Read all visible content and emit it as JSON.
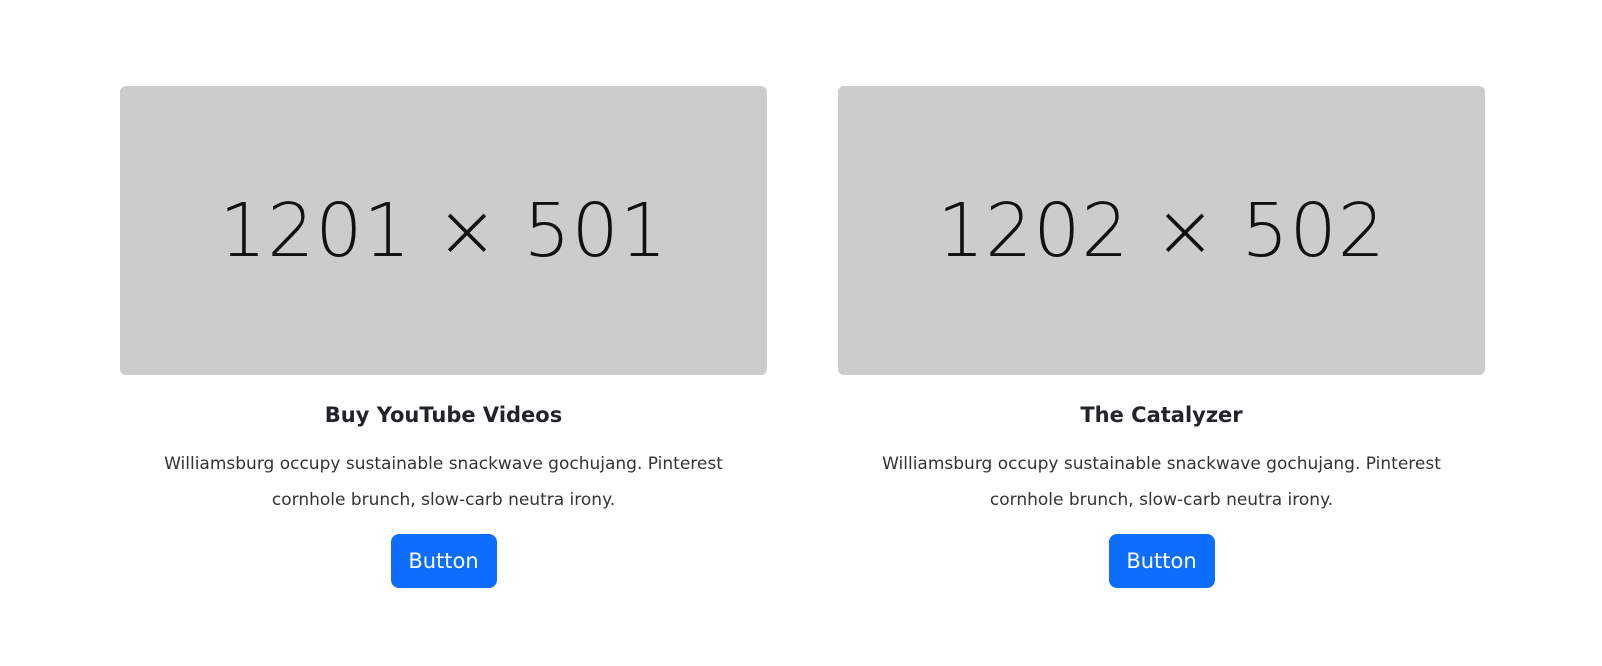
{
  "cards": [
    {
      "image_text": "1201 × 501",
      "title": "Buy YouTube Videos",
      "text": "Williamsburg occupy sustainable snackwave gochujang. Pinterest cornhole brunch, slow-carb neutra irony.",
      "button_label": "Button"
    },
    {
      "image_text": "1202 × 502",
      "title": "The Catalyzer",
      "text": "Williamsburg occupy sustainable snackwave gochujang. Pinterest cornhole brunch, slow-carb neutra irony.",
      "button_label": "Button"
    }
  ],
  "colors": {
    "placeholder_bg": "#cccccc",
    "button_bg": "#0d6efd",
    "button_text": "#ffffff"
  }
}
